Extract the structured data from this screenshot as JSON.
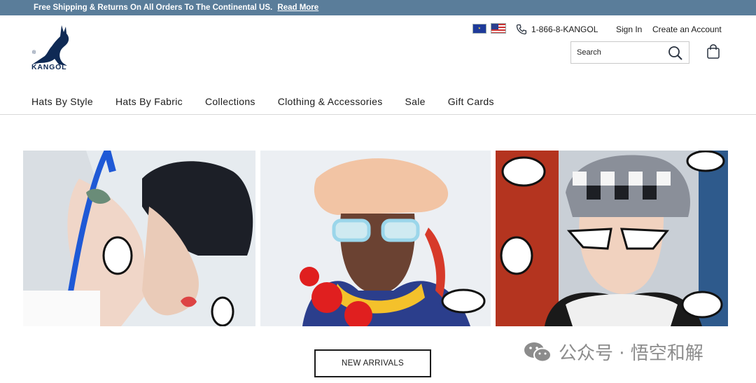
{
  "announcement": {
    "text": "Free Shipping & Returns On All Orders To The Continental US.",
    "link": "Read More"
  },
  "brand": {
    "name": "KANGOL",
    "registered": "®"
  },
  "utility": {
    "phone": "1-866-8-KANGOL",
    "sign_in": "Sign In",
    "create_account": "Create an Account",
    "flags": [
      "eu-flag-icon",
      "us-flag-icon"
    ]
  },
  "search": {
    "placeholder": "Search"
  },
  "nav": {
    "items": [
      "Hats By Style",
      "Hats By Fabric",
      "Collections",
      "Clothing & Accessories",
      "Sale",
      "Gift Cards"
    ]
  },
  "hero": {
    "images": [
      "model-black-bucket-hat-photo",
      "model-fuzzy-beret-photo",
      "model-checkered-bucket-hat-photo"
    ],
    "cta": "NEW ARRIVALS"
  },
  "watermark": {
    "text": "公众号 · 悟空和解"
  },
  "colors": {
    "announcement_bg": "#5a7d9a",
    "brand_navy": "#0f2a55",
    "text": "#1b1b1b"
  }
}
